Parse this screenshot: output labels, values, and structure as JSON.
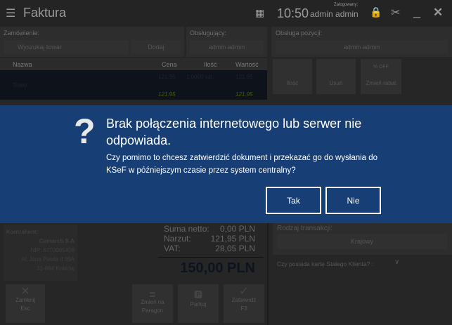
{
  "header": {
    "title": "Faktura",
    "time": "10:50",
    "logged_label": "Zalogowany:",
    "user": "admin admin"
  },
  "order": {
    "label": "Zamówienie:",
    "search_placeholder": "Wyszukaj towar",
    "add_label": "Dodaj"
  },
  "attendant": {
    "label": "Obsługujący:",
    "value": "admin admin"
  },
  "table": {
    "headers": [
      "Nazwa",
      "Cena",
      "Ilość",
      "Wartość"
    ],
    "row": {
      "name": "Towar",
      "price": "121,95",
      "qty": "1,0000 szt.",
      "value": "121,95",
      "price2": "121,95",
      "value2": "121,95"
    }
  },
  "position": {
    "label": "Obsługa pozycji:",
    "value": "admin admin",
    "buttons": [
      "Ilość",
      "Usuń",
      "Zmień rabat"
    ],
    "discount_glyph": "% OFF"
  },
  "dialog": {
    "title": "Brak połączenia internetowego lub serwer nie odpowiada.",
    "message": "Czy pomimo to chcesz zatwierdzić dokument i przekazać go do wysłania do KSeF w późniejszym czasie przez system centralny?",
    "yes": "Tak",
    "no": "Nie"
  },
  "contractor": {
    "label": "Kontrahent:",
    "name": "Comarch S.A",
    "nip": "NIP: 6770065406",
    "street": "Al. Jana Pawła II 39A",
    "city": "31-864 Kraków"
  },
  "sums": {
    "net_label": "Suma netto:",
    "net": "0,00 PLN",
    "markup_label": "Narzut:",
    "markup": "121,95 PLN",
    "vat_label": "VAT:",
    "vat": "28,05 PLN",
    "total": "150,00 PLN"
  },
  "bottom_buttons": {
    "close": "Zamknij",
    "close_key": "Esc",
    "receipt": "Zmień na Paragon",
    "park": "Parkuj",
    "confirm": "Zatwierdź",
    "confirm_key": "F3"
  },
  "transaction": {
    "label": "Rodzaj transakcji:",
    "value": "Krajowy",
    "loyalty_question": "Czy posiada kartę Stałego Klienta? :"
  }
}
